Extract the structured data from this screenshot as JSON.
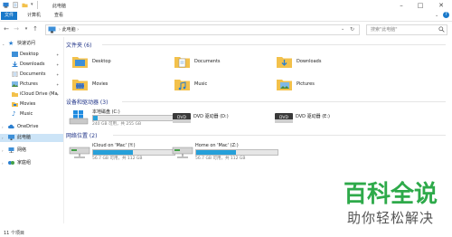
{
  "window": {
    "title": "此电脑"
  },
  "ribbon": {
    "tabs": [
      "文件",
      "计算机",
      "查看"
    ]
  },
  "nav": {
    "address": "此电脑",
    "search_placeholder": "搜索\"此电脑\""
  },
  "sidebar": {
    "items": [
      {
        "label": "快速访问",
        "icon": "star-icon"
      },
      {
        "label": "Desktop",
        "icon": "desktop-icon",
        "pinned": true
      },
      {
        "label": "Downloads",
        "icon": "download-icon",
        "pinned": true
      },
      {
        "label": "Documents",
        "icon": "documents-icon",
        "pinned": true
      },
      {
        "label": "Pictures",
        "icon": "pictures-icon",
        "pinned": true
      },
      {
        "label": "iCloud Drive (Ma",
        "icon": "folder-icon",
        "pinned": true
      },
      {
        "label": "Movies",
        "icon": "movies-icon"
      },
      {
        "label": "Music",
        "icon": "music-icon"
      },
      {
        "label": "OneDrive",
        "icon": "cloud-icon"
      },
      {
        "label": "此电脑",
        "icon": "computer-icon",
        "selected": true
      },
      {
        "label": "网络",
        "icon": "network-icon"
      },
      {
        "label": "家庭组",
        "icon": "homegroup-icon"
      }
    ]
  },
  "groups": {
    "folders": {
      "title": "文件夹 (6)",
      "items": [
        "Desktop",
        "Documents",
        "Downloads",
        "Movies",
        "Music",
        "Pictures"
      ]
    },
    "devices": {
      "title": "设备和驱动器 (3)",
      "items": [
        {
          "name": "本地磁盘 (C:)",
          "size": "240 GB 可用，共 255 GB",
          "used_fraction": 0.06
        },
        {
          "name": "DVD 驱动器 (D:)"
        },
        {
          "name": "DVD 驱动器 (E:)"
        }
      ]
    },
    "network": {
      "title": "网络位置 (2)",
      "items": [
        {
          "name": "iCloud on 'Mac' (Y:)",
          "size": "56.7 GB 可用，共 112 GB",
          "used_fraction": 0.49
        },
        {
          "name": "Home on 'Mac' (Z:)",
          "size": "56.7 GB 可用，共 112 GB",
          "used_fraction": 0.49
        }
      ]
    }
  },
  "status": {
    "count": "11 个项目"
  },
  "watermark": {
    "title": "百科全说",
    "subtitle": "助你轻松解决"
  },
  "colors": {
    "accent": "#1979ca",
    "folder": "#f3c14b",
    "watermark": "#2eaa4a",
    "drive_fill": "#26a0da"
  }
}
